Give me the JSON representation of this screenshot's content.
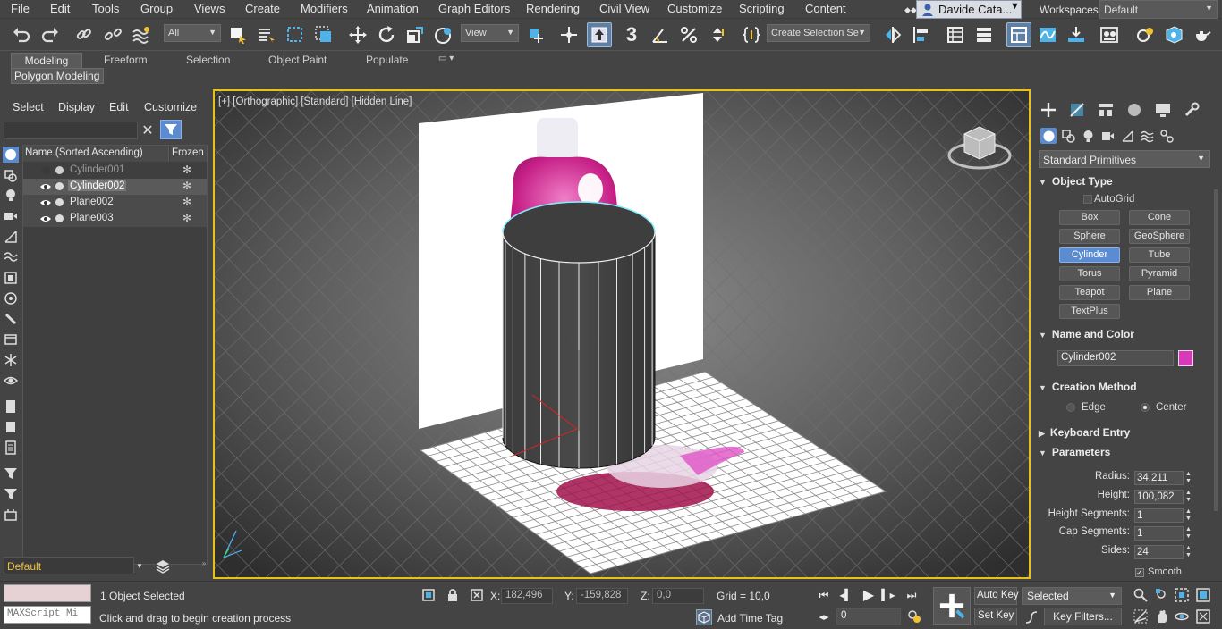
{
  "menu": [
    "File",
    "Edit",
    "Tools",
    "Group",
    "Views",
    "Create",
    "Modifiers",
    "Animation",
    "Graph Editors",
    "Rendering",
    "Civil View",
    "Customize",
    "Scripting",
    "Content"
  ],
  "user": "Davide Cata...",
  "workspaces": {
    "label": "Workspaces:",
    "value": "Default"
  },
  "toolbar": {
    "selection_filter": "All",
    "ref_coord": "View",
    "named_selection": "Create Selection Se",
    "snap_angle_label": "3"
  },
  "ribbon": {
    "tabs": [
      "Modeling",
      "Freeform",
      "Selection",
      "Object Paint",
      "Populate"
    ],
    "active_tab": "Modeling",
    "panel": "Polygon Modeling"
  },
  "scene_explorer": {
    "menus": [
      "Select",
      "Display",
      "Edit",
      "Customize"
    ],
    "columns": [
      "Name (Sorted Ascending)",
      "Frozen"
    ],
    "rows": [
      {
        "name": "Cylinder001",
        "hidden": true
      },
      {
        "name": "Cylinder002",
        "selected": true
      },
      {
        "name": "Plane002"
      },
      {
        "name": "Plane003"
      }
    ],
    "layer": "Default"
  },
  "viewport": {
    "label": "[+] [Orthographic] [Standard] [Hidden Line]"
  },
  "command_panel": {
    "category": "Standard Primitives",
    "object_type": {
      "title": "Object Type",
      "autogrid": "AutoGrid",
      "buttons": [
        "Box",
        "Cone",
        "Sphere",
        "GeoSphere",
        "Cylinder",
        "Tube",
        "Torus",
        "Pyramid",
        "Teapot",
        "Plane",
        "TextPlus"
      ],
      "active": "Cylinder"
    },
    "name_and_color": {
      "title": "Name and Color",
      "name": "Cylinder002",
      "color": "#d63ab8"
    },
    "creation_method": {
      "title": "Creation Method",
      "options": [
        "Edge",
        "Center"
      ],
      "selected": "Center"
    },
    "keyboard_entry": {
      "title": "Keyboard Entry"
    },
    "parameters": {
      "title": "Parameters",
      "fields": [
        {
          "label": "Radius:",
          "value": "34,211"
        },
        {
          "label": "Height:",
          "value": "100,082"
        },
        {
          "label": "Height Segments:",
          "value": "1"
        },
        {
          "label": "Cap Segments:",
          "value": "1"
        },
        {
          "label": "Sides:",
          "value": "24"
        }
      ],
      "smooth": "Smooth"
    }
  },
  "status": {
    "selected": "1 Object Selected",
    "prompt": "Click and drag to begin creation process",
    "script_placeholder": "MAXScript Mi",
    "x_label": "X:",
    "x": "182,496",
    "y_label": "Y:",
    "y": "-159,828",
    "z_label": "Z:",
    "z": "0,0",
    "grid": "Grid = 10,0",
    "add_time_tag": "Add Time Tag",
    "frame": "0",
    "auto_key": "Auto Key",
    "set_key": "Set Key",
    "key_mode": "Selected",
    "key_filters": "Key Filters..."
  },
  "colors": {
    "accent": "#5b8bd1",
    "viewport_border": "#e8c11a",
    "object_color": "#d63ab8",
    "layer_text": "#f0c040"
  }
}
